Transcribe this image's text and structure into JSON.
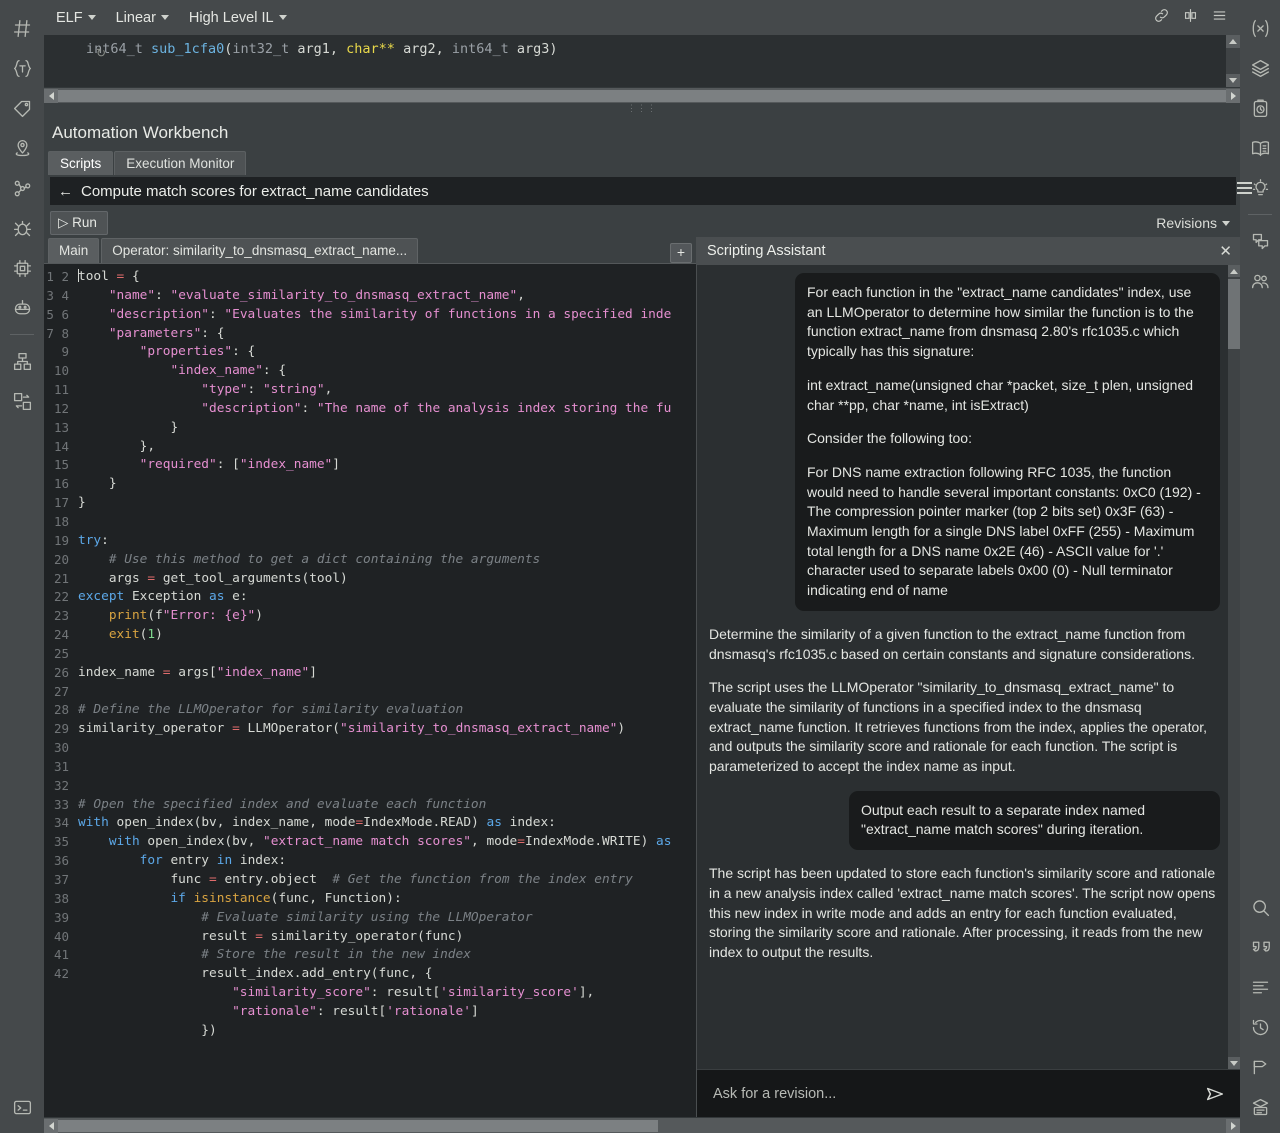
{
  "left_rail": [
    {
      "name": "symbols-icon",
      "title": "Symbols"
    },
    {
      "name": "types-icon",
      "title": "Types"
    },
    {
      "name": "tags-icon",
      "title": "Tags"
    },
    {
      "name": "bookmarks-icon",
      "title": "Bookmarks"
    },
    {
      "name": "graph-icon",
      "title": "Cross references"
    },
    {
      "name": "bug-icon",
      "title": "Debugger"
    },
    {
      "name": "chip-icon",
      "title": "Platform"
    },
    {
      "name": "robot-icon",
      "title": "Sidekick"
    },
    {
      "name": "components-icon",
      "title": "Components"
    },
    {
      "name": "diff-icon",
      "title": "Diff"
    }
  ],
  "left_rail_bottom": [
    {
      "name": "console-icon",
      "title": "Console"
    }
  ],
  "right_rail": [
    {
      "name": "variables-icon",
      "title": "Variables"
    },
    {
      "name": "layers-icon",
      "title": "Stack"
    },
    {
      "name": "clipboard-clock-icon",
      "title": "History"
    },
    {
      "name": "book-icon",
      "title": "Documentation"
    },
    {
      "name": "lightbulb-icon",
      "title": "Hints"
    },
    {
      "name": "comments-icon",
      "title": "Comments"
    },
    {
      "name": "users-icon",
      "title": "Collaboration"
    }
  ],
  "right_rail_bottom": [
    {
      "name": "search-icon",
      "title": "Search"
    },
    {
      "name": "quote-icon",
      "title": "Strings"
    },
    {
      "name": "lines-icon",
      "title": "Log"
    },
    {
      "name": "history-icon",
      "title": "Time travel"
    },
    {
      "name": "tag-flag-icon",
      "title": "Tags"
    },
    {
      "name": "stack-print-icon",
      "title": "Report"
    }
  ],
  "topbar": {
    "view_format": "ELF",
    "view_mode": "Linear",
    "il_level": "High Level IL",
    "actions": [
      {
        "name": "link-icon"
      },
      {
        "name": "split-pane-icon"
      },
      {
        "name": "menu-icon"
      }
    ]
  },
  "disassembly": {
    "return_type": "int64_t",
    "func_name": "sub_1cfa0",
    "p_open": "(",
    "arg1_type": "int32_t",
    "arg1_name": " arg1, ",
    "arg2_type": "char**",
    "arg2_name": " arg2, ",
    "arg3_type": "int64_t",
    "arg3_name": " arg3",
    "p_close": ")"
  },
  "workbench": {
    "title": "Automation Workbench",
    "tabs": [
      {
        "label": "Scripts",
        "active": true
      },
      {
        "label": "Execution Monitor",
        "active": false
      }
    ],
    "script_name": "Compute match scores for extract_name candidates",
    "back_arrow": "←",
    "run_label": "▷ Run",
    "revisions_label": "Revisions",
    "editor_tabs": [
      {
        "label": "Main",
        "active": true
      },
      {
        "label": "Operator: similarity_to_dnsmasq_extract_name...",
        "active": false
      }
    ],
    "add_tab_label": "+"
  },
  "code": {
    "first_line": 1,
    "last_line": 42,
    "lines": [
      "tool = {",
      "    \"name\": \"evaluate_similarity_to_dnsmasq_extract_name\",",
      "    \"description\": \"Evaluates the similarity of functions in a specified inde",
      "    \"parameters\": {",
      "        \"properties\": {",
      "            \"index_name\": {",
      "                \"type\": \"string\",",
      "                \"description\": \"The name of the analysis index storing the fu",
      "            }",
      "        },",
      "        \"required\": [\"index_name\"]",
      "    }",
      "}",
      "",
      "try:",
      "    # Use this method to get a dict containing the arguments",
      "    args = get_tool_arguments(tool)",
      "except Exception as e:",
      "    print(f\"Error: {e}\")",
      "    exit(1)",
      "",
      "index_name = args[\"index_name\"]",
      "",
      "# Define the LLMOperator for similarity evaluation",
      "similarity_operator = LLMOperator(\"similarity_to_dnsmasq_extract_name\")",
      "",
      "",
      "",
      "# Open the specified index and evaluate each function",
      "with open_index(bv, index_name, mode=IndexMode.READ) as index:",
      "    with open_index(bv, \"extract_name match scores\", mode=IndexMode.WRITE) as",
      "        for entry in index:",
      "            func = entry.object  # Get the function from the index entry",
      "            if isinstance(func, Function):",
      "                # Evaluate similarity using the LLMOperator",
      "                result = similarity_operator(func)",
      "                # Store the result in the new index",
      "                result_index.add_entry(func, {",
      "                    \"similarity_score\": result['similarity_score'],",
      "                    \"rationale\": result['rationale']",
      "                })",
      ""
    ]
  },
  "assistant": {
    "title": "Scripting Assistant",
    "close_label": "✕",
    "messages": [
      {
        "role": "user",
        "paragraphs": [
          "For each function in the \"extract_name candidates\" index, use an LLMOperator to determine how similar the function is to the function extract_name from dnsmasq 2.80's rfc1035.c which typically has this signature:",
          "int extract_name(unsigned char *packet, size_t plen, unsigned char **pp, char *name, int isExtract)",
          "Consider the following too:",
          "For DNS name extraction following RFC 1035, the function would need to handle several important constants: 0xC0 (192) - The compression pointer marker (top 2 bits set) 0x3F (63) - Maximum length for a single DNS label 0xFF (255) - Maximum total length for a DNS name 0x2E (46) - ASCII value for '.' character used to separate labels 0x00 (0) - Null terminator indicating end of name"
        ]
      },
      {
        "role": "bot",
        "paragraphs": [
          "Determine the similarity of a given function to the extract_name function from dnsmasq's rfc1035.c based on certain constants and signature considerations.",
          "The script uses the LLMOperator \"similarity_to_dnsmasq_extract_name\" to evaluate the similarity of functions in a specified index to the dnsmasq extract_name function. It retrieves functions from the index, applies the operator, and outputs the similarity score and rationale for each function. The script is parameterized to accept the index name as input."
        ]
      },
      {
        "role": "user",
        "short": true,
        "paragraphs": [
          "Output each result to a separate index named \"extract_name match scores\" during iteration."
        ]
      },
      {
        "role": "bot",
        "paragraphs": [
          "The script has been updated to store each function's similarity score and rationale in a new analysis index called 'extract_name match scores'. The script now opens this new index in write mode and adds an entry for each function evaluated, storing the similarity score and rationale. After processing, it reads from the new index to output the results."
        ]
      }
    ],
    "input_placeholder": "Ask for a revision...",
    "send_icon": "send-icon"
  },
  "colors": {
    "accent_blue": "#5ca8e8",
    "string_pink": "#e58fd0",
    "comment_gray": "#7b8186",
    "panel_bg": "#3b4042",
    "editor_bg": "#1f2224"
  }
}
